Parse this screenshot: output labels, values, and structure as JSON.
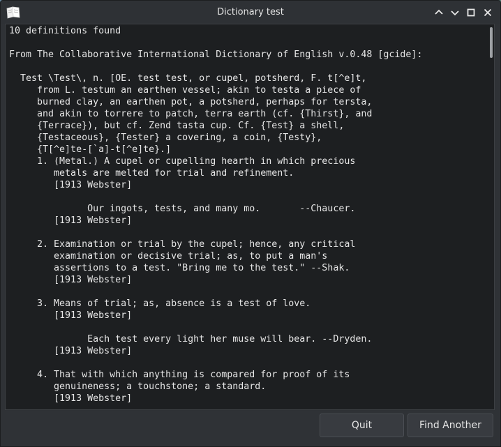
{
  "window": {
    "title": "Dictionary test"
  },
  "icons": {
    "app": "book-icon",
    "minimize": "chevron-up-icon",
    "keep_below": "chevron-down-icon",
    "maximize": "maximize-icon",
    "close": "close-icon"
  },
  "content": {
    "lines": [
      "10 definitions found",
      "",
      "From The Collaborative International Dictionary of English v.0.48 [gcide]:",
      "",
      "  Test \\Test\\, n. [OE. test test, or cupel, potsherd, F. t[^e]t,",
      "     from L. testum an earthen vessel; akin to testa a piece of",
      "     burned clay, an earthen pot, a potsherd, perhaps for tersta,",
      "     and akin to torrere to patch, terra earth (cf. {Thirst}, and",
      "     {Terrace}), but cf. Zend tasta cup. Cf. {Test} a shell,",
      "     {Testaceous}, {Tester} a covering, a coin, {Testy},",
      "     {T[^e]te-[`a]-t[^e]te}.]",
      "     1. (Metal.) A cupel or cupelling hearth in which precious",
      "        metals are melted for trial and refinement.",
      "        [1913 Webster]",
      "",
      "              Our ingots, tests, and many mo.       --Chaucer.",
      "        [1913 Webster]",
      "",
      "     2. Examination or trial by the cupel; hence, any critical",
      "        examination or decisive trial; as, to put a man's",
      "        assertions to a test. \"Bring me to the test.\" --Shak.",
      "        [1913 Webster]",
      "",
      "     3. Means of trial; as, absence is a test of love.",
      "        [1913 Webster]",
      "",
      "              Each test every light her muse will bear. --Dryden.",
      "        [1913 Webster]",
      "",
      "     4. That with which anything is compared for proof of its",
      "        genuineness; a touchstone; a standard.",
      "        [1913 Webster]"
    ]
  },
  "buttons": {
    "quit": "Quit",
    "find_another": "Find Another"
  }
}
